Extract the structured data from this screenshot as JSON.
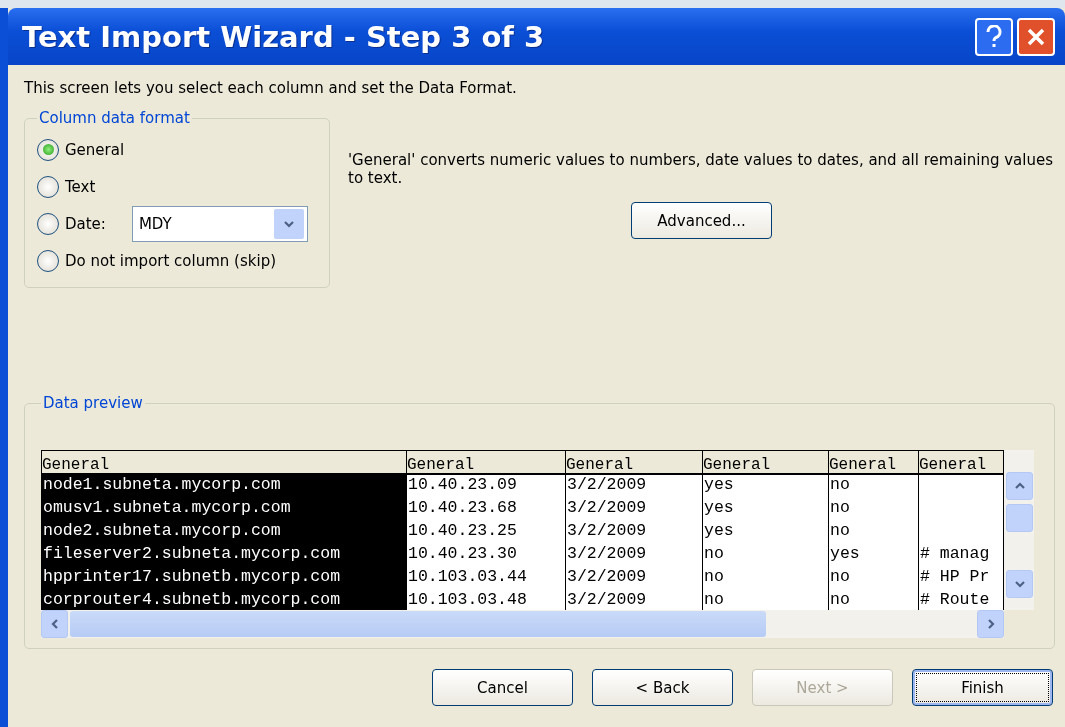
{
  "window": {
    "title": "Text Import Wizard - Step 3 of 3"
  },
  "intro": "This screen lets you select each column and set the Data Format.",
  "column_data_format": {
    "legend": "Column data format",
    "options": [
      {
        "label": "General",
        "selected": true,
        "kind": "plain"
      },
      {
        "label": "Text",
        "selected": false,
        "kind": "plain"
      },
      {
        "label": "Date:",
        "selected": false,
        "kind": "date",
        "value": "MDY"
      },
      {
        "label": "Do not import column (skip)",
        "selected": false,
        "kind": "plain"
      }
    ]
  },
  "description": "'General' converts numeric values to numbers, date values to dates, and all remaining values to text.",
  "advanced_button": "Advanced...",
  "data_preview": {
    "legend": "Data preview",
    "columns": [
      {
        "header": "General",
        "selected": true
      },
      {
        "header": "General",
        "selected": false
      },
      {
        "header": "General",
        "selected": false
      },
      {
        "header": "General",
        "selected": false
      },
      {
        "header": "General",
        "selected": false
      },
      {
        "header": "General",
        "selected": false
      }
    ],
    "rows": [
      [
        "node1.subneta.mycorp.com",
        "10.40.23.09",
        "3/2/2009",
        "yes",
        "no"
      ],
      [
        "omusv1.subneta.mycorp.com",
        "10.40.23.68",
        "3/2/2009",
        "yes",
        "no"
      ],
      [
        "node2.subneta.mycorp.com",
        "10.40.23.25",
        "3/2/2009",
        "yes",
        "no"
      ],
      [
        "fileserver2.subneta.mycorp.com",
        "10.40.23.30",
        "3/2/2009",
        "no",
        "yes",
        "# manag"
      ],
      [
        "hpprinter17.subnetb.mycorp.com",
        "10.103.03.44",
        "3/2/2009",
        "no",
        "no",
        "# HP Pr"
      ],
      [
        "corprouter4.subnetb.mycorp.com",
        "10.103.03.48",
        "3/2/2009",
        "no",
        "no",
        "# Route"
      ]
    ]
  },
  "buttons": [
    {
      "label": "Cancel",
      "disabled": false,
      "default": false
    },
    {
      "label": "< Back",
      "disabled": false,
      "default": false
    },
    {
      "label": "Next >",
      "disabled": true,
      "default": false
    },
    {
      "label": "Finish",
      "disabled": false,
      "default": true
    }
  ]
}
